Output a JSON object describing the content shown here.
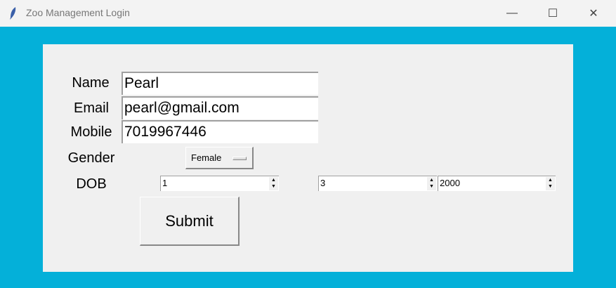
{
  "window": {
    "title": "Zoo Management Login",
    "minimize": "—",
    "maximize": "☐",
    "close": "✕"
  },
  "form": {
    "name_label": "Name",
    "name_value": "Pearl",
    "email_label": "Email",
    "email_value": "pearl@gmail.com",
    "mobile_label": "Mobile",
    "mobile_value": "7019967446",
    "gender_label": "Gender",
    "gender_value": "Female",
    "dob_label": "DOB",
    "dob_day": "1",
    "dob_month": "3",
    "dob_year": "2000",
    "submit_label": "Submit"
  },
  "colors": {
    "background": "#04b0d9",
    "panel": "#f0f0f0"
  }
}
